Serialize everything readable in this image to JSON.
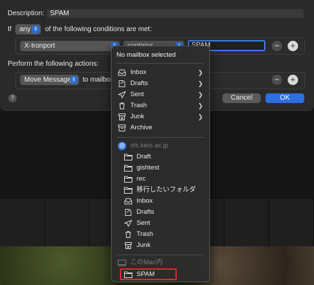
{
  "rule": {
    "description_label": "Description:",
    "description_value": "SPAM",
    "if_label": "If",
    "match_mode": "any",
    "conditions_suffix": "of the following conditions are met:",
    "condition": {
      "header": "X-Ironport",
      "operator": "contains",
      "value": "SPAM"
    },
    "actions_label": "Perform the following actions:",
    "action": {
      "type": "Move Message",
      "to_label": "to mailbox"
    },
    "remove_label": "−",
    "add_label": "+",
    "help_label": "?",
    "cancel_label": "Cancel",
    "ok_label": "OK"
  },
  "menu": {
    "header": "No mailbox selected",
    "top_items": [
      {
        "label": "Inbox",
        "icon": "inbox-icon",
        "has_submenu": true
      },
      {
        "label": "Drafts",
        "icon": "drafts-icon",
        "has_submenu": true
      },
      {
        "label": "Sent",
        "icon": "sent-icon",
        "has_submenu": true
      },
      {
        "label": "Trash",
        "icon": "trash-icon",
        "has_submenu": true
      },
      {
        "label": "Junk",
        "icon": "junk-icon",
        "has_submenu": true
      },
      {
        "label": "Archive",
        "icon": "archive-icon",
        "has_submenu": false
      }
    ],
    "account": {
      "name": "sfc.keio.ac.jp",
      "icon": "at-icon",
      "items": [
        {
          "label": "Draft",
          "icon": "folder-icon"
        },
        {
          "label": "gishtest",
          "icon": "folder-icon"
        },
        {
          "label": "rec",
          "icon": "folder-icon"
        },
        {
          "label": "移行したいフォルダ",
          "icon": "folder-icon"
        },
        {
          "label": "Inbox",
          "icon": "inbox-icon"
        },
        {
          "label": "Drafts",
          "icon": "drafts-icon"
        },
        {
          "label": "Sent",
          "icon": "sent-icon"
        },
        {
          "label": "Trash",
          "icon": "trash-icon"
        },
        {
          "label": "Junk",
          "icon": "junk-icon"
        }
      ]
    },
    "local": {
      "name": "このMac内",
      "icon": "computer-icon",
      "items": [
        {
          "label": "SPAM",
          "icon": "folder-icon"
        }
      ]
    }
  },
  "colors": {
    "accent": "#2d6ee0",
    "highlight": "#e0282c"
  }
}
